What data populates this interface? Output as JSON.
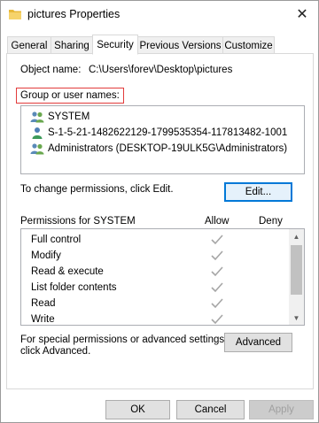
{
  "window": {
    "title": "pictures Properties",
    "close_glyph": "✕"
  },
  "tabs": [
    {
      "label": "General",
      "active": false
    },
    {
      "label": "Sharing",
      "active": false
    },
    {
      "label": "Security",
      "active": true
    },
    {
      "label": "Previous Versions",
      "active": false
    },
    {
      "label": "Customize",
      "active": false
    }
  ],
  "security": {
    "object_label": "Object name:",
    "object_value": "C:\\Users\\forev\\Desktop\\pictures",
    "group_label": "Group or user names:",
    "users": [
      {
        "name": "SYSTEM",
        "icon": "users-group-icon"
      },
      {
        "name": "S-1-5-21-1482622129-1799535354-117813482-1001",
        "icon": "user-icon"
      },
      {
        "name": "Administrators (DESKTOP-19ULK5G\\Administrators)",
        "icon": "users-group-icon"
      }
    ],
    "change_text": "To change permissions, click Edit.",
    "edit_button": "Edit...",
    "permissions_header": "Permissions for SYSTEM",
    "allow_header": "Allow",
    "deny_header": "Deny",
    "permissions": [
      {
        "name": "Full control",
        "allow": true,
        "deny": false
      },
      {
        "name": "Modify",
        "allow": true,
        "deny": false
      },
      {
        "name": "Read & execute",
        "allow": true,
        "deny": false
      },
      {
        "name": "List folder contents",
        "allow": true,
        "deny": false
      },
      {
        "name": "Read",
        "allow": true,
        "deny": false
      },
      {
        "name": "Write",
        "allow": true,
        "deny": false
      }
    ],
    "special_text_line1": "For special permissions or advanced settings,",
    "special_text_line2": "click Advanced.",
    "advanced_button": "Advanced"
  },
  "footer": {
    "ok": "OK",
    "cancel": "Cancel",
    "apply": "Apply"
  },
  "colors": {
    "highlight_border": "#e23b3b",
    "focus_border": "#0078d7",
    "check_gray": "#a6a6a6"
  }
}
